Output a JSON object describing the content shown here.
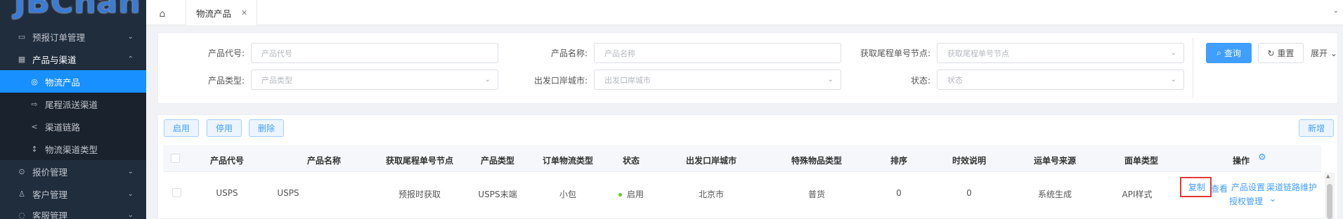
{
  "sidebar": {
    "logo_text": "JBChan",
    "items": [
      {
        "label": "预报订单管理",
        "icon": "▭",
        "arrow": "⌄"
      },
      {
        "label": "产品与渠道",
        "icon": "▦",
        "arrow": "⌃"
      },
      {
        "label": "物流产品",
        "icon": "◎"
      },
      {
        "label": "尾程派送渠道",
        "icon": "⇨"
      },
      {
        "label": "渠道链路",
        "icon": "<"
      },
      {
        "label": "物流渠道类型",
        "icon": "↕"
      },
      {
        "label": "报价管理",
        "icon": "⊙",
        "arrow": "⌄"
      },
      {
        "label": "客户管理",
        "icon": "♙",
        "arrow": "⌄"
      },
      {
        "label": "客服管理",
        "icon": "◌",
        "arrow": "⌄"
      }
    ]
  },
  "tabs": {
    "home_icon": "⌂",
    "active_tab": "物流产品",
    "close_icon": "✕",
    "collapse_icon": "⌄"
  },
  "search": {
    "product_code": {
      "label": "产品代号:",
      "placeholder": "产品代号"
    },
    "product_name": {
      "label": "产品名称:",
      "placeholder": "产品名称"
    },
    "tail_node": {
      "label": "获取尾程单号节点:",
      "placeholder": "获取尾程单号节点"
    },
    "product_type": {
      "label": "产品类型:",
      "placeholder": "产品类型"
    },
    "port_city": {
      "label": "出发口岸城市:",
      "placeholder": "出发口岸城市"
    },
    "status": {
      "label": "状态:",
      "placeholder": "状态"
    },
    "query_label": "查询",
    "reset_label": "重置",
    "expand_label": "展开",
    "query_icon": "⌕",
    "reset_icon": "↻",
    "expand_icon": "⌄",
    "caret": "⌄"
  },
  "toolbar": {
    "enable_label": "启用",
    "disable_label": "停用",
    "delete_label": "删除",
    "add_label": "新增"
  },
  "table": {
    "columns": [
      "产品代号",
      "产品名称",
      "获取尾程单号节点",
      "产品类型",
      "订单物流类型",
      "状态",
      "出发口岸城市",
      "特殊物品类型",
      "排序",
      "时效说明",
      "运单号来源",
      "面单类型",
      "操作"
    ],
    "rows": [
      {
        "code": "USPS",
        "name": "USPS",
        "tail_node": "预报时获取",
        "product_type": "USPS末端",
        "logistics_type": "小包",
        "status": "启用",
        "port_city": "北京市",
        "special_type": "普货",
        "sort": "0",
        "timeliness": "0",
        "waybill_source": "系统生成",
        "label_type": "API样式",
        "actions": {
          "copy": "复制",
          "view": "查看",
          "settings": "产品设置",
          "link": "渠道链路维护",
          "auth": "授权管理",
          "more_icon": "⌄"
        }
      }
    ],
    "gear_icon": "⚙",
    "scroll_up_icon": "▲"
  },
  "colors": {
    "sidebar_bg": "#1f2d3d",
    "accent": "#409eff",
    "active_menu": "#1890ff",
    "status_enabled": "#67c23a",
    "highlight_box": "#e53935"
  }
}
